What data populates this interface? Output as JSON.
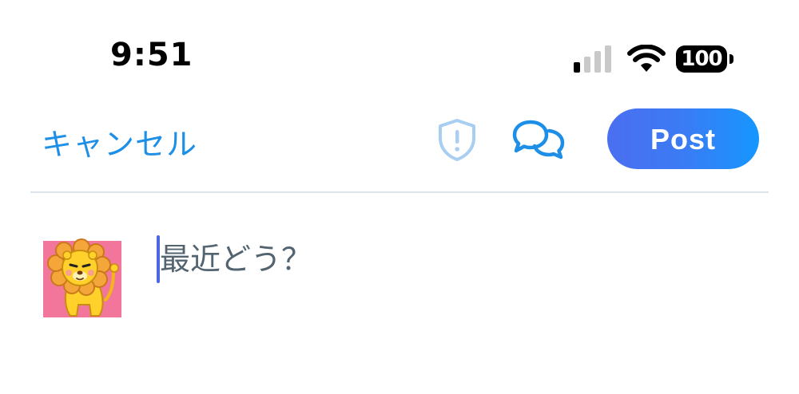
{
  "status_bar": {
    "time": "9:51",
    "battery_level": "100",
    "signal_bars_active": 1,
    "signal_bars_total": 4
  },
  "header": {
    "cancel_label": "キャンセル",
    "post_label": "Post"
  },
  "icons": {
    "shield": "shield-alert-icon",
    "chat": "chat-bubbles-icon",
    "signal": "cellular-signal-icon",
    "wifi": "wifi-icon",
    "battery": "battery-icon"
  },
  "composer": {
    "placeholder": "最近どう？",
    "value": ""
  },
  "colors": {
    "accent": "#1d8fe6",
    "post_gradient_start": "#4a6ff0",
    "post_gradient_end": "#1597ff",
    "caret": "#4d66e6",
    "shield": "#a8cff2",
    "avatar_bg": "#f2769c"
  }
}
